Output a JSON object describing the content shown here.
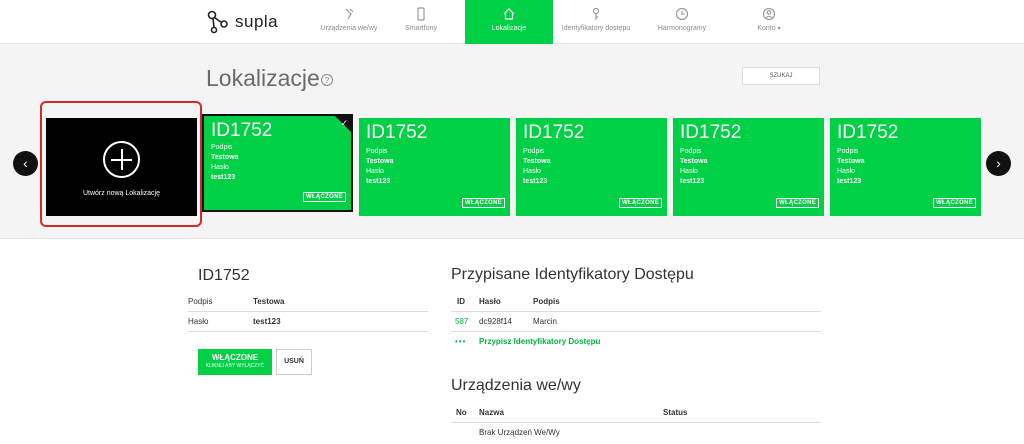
{
  "app": {
    "logo_text": "supla"
  },
  "nav": [
    {
      "label": "Urządzenia we/wy",
      "icon": "device-icon",
      "active": false
    },
    {
      "label": "Smartfony",
      "icon": "smartphone-icon",
      "active": false
    },
    {
      "label": "Lokalizacje",
      "icon": "home-icon",
      "active": true
    },
    {
      "label": "Identyfikatory dostępu",
      "icon": "key-icon",
      "active": false
    },
    {
      "label": "Harmonogramy",
      "icon": "clock-icon",
      "active": false
    },
    {
      "label": "Konto",
      "icon": "account-icon",
      "active": false,
      "caret": "▾"
    }
  ],
  "page": {
    "title": "Lokalizacje",
    "help": "?",
    "search_label": "SZUKAJ"
  },
  "carousel": {
    "prev": "‹",
    "next": "›",
    "new_location_label": "Utwórz nową Lokalizację",
    "cards": [
      {
        "id": "ID1752",
        "caption_label": "Podpis",
        "caption": "Testowa",
        "password_label": "Hasło",
        "password": "test123",
        "status": "WŁĄCZONE",
        "selected": true,
        "check": "✓"
      },
      {
        "id": "ID1752",
        "caption_label": "Podpis",
        "caption": "Testowa",
        "password_label": "Hasło",
        "password": "test123",
        "status": "WŁĄCZONE",
        "selected": false
      },
      {
        "id": "ID1752",
        "caption_label": "Podpis",
        "caption": "Testowa",
        "password_label": "Hasło",
        "password": "test123",
        "status": "WŁĄCZONE",
        "selected": false
      },
      {
        "id": "ID1752",
        "caption_label": "Podpis",
        "caption": "Testowa",
        "password_label": "Hasło",
        "password": "test123",
        "status": "WŁĄCZONE",
        "selected": false
      },
      {
        "id": "ID1752",
        "caption_label": "Podpis",
        "caption": "Testowa",
        "password_label": "Hasło",
        "password": "test123",
        "status": "WŁĄCZONE",
        "selected": false
      }
    ]
  },
  "details": {
    "title": "ID1752",
    "rows": [
      {
        "label": "Podpis",
        "value": "Testowa"
      },
      {
        "label": "Hasło",
        "value": "test123"
      }
    ],
    "enabled_button": {
      "label": "WŁĄCZONE",
      "sublabel": "KLIKNIJ ABY WYŁĄCZYĆ"
    },
    "remove_button": "USUŃ"
  },
  "access_ids": {
    "title": "Przypisane Identyfikatory Dostępu",
    "headers": {
      "id": "ID",
      "password": "Hasło",
      "caption": "Podpis"
    },
    "rows": [
      {
        "id": "587",
        "password": "dc928f14",
        "caption": "Marcin"
      }
    ],
    "assign_dots": "•••",
    "assign_label": "Przypisz Identyfikatory Dostępu"
  },
  "devices": {
    "title": "Urządzenia we/wy",
    "headers": {
      "no": "No",
      "name": "Nazwa",
      "status": "Status"
    },
    "empty": "Brak Urządzeń We/Wy"
  },
  "colors": {
    "accent": "#00d046",
    "highlight": "#d42a2a",
    "dark": "#000000"
  }
}
